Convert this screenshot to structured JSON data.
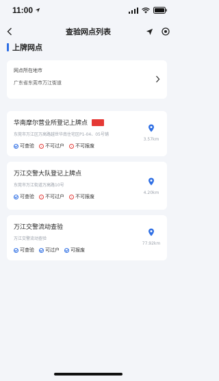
{
  "status_bar": {
    "time": "11:00"
  },
  "nav": {
    "title": "查验网点列表"
  },
  "section": {
    "title": "上牌网点"
  },
  "city": {
    "label": "网点所在地市",
    "value": "广东省东莞市万江街道"
  },
  "sites": [
    {
      "name": "华南摩尔营业所登记上牌点",
      "address": "东莞市万江区万高路越世华南住宅区P1-04、05号铺",
      "distance": "3.57km",
      "tags": [
        {
          "label": "可查验",
          "status": "ok"
        },
        {
          "label": "不可过户",
          "status": "no"
        },
        {
          "label": "不可报废",
          "status": "no"
        }
      ]
    },
    {
      "name": "万江交警大队登记上牌点",
      "address": "东莞市万江街道万高路10号",
      "distance": "4.20km",
      "tags": [
        {
          "label": "可查验",
          "status": "ok"
        },
        {
          "label": "不可过户",
          "status": "no"
        },
        {
          "label": "不可报废",
          "status": "no"
        }
      ]
    },
    {
      "name": "万江交警流动查验",
      "address": "万江交警流动查验",
      "distance": "77.92km",
      "tags": [
        {
          "label": "可查验",
          "status": "ok"
        },
        {
          "label": "可过户",
          "status": "ok"
        },
        {
          "label": "可报废",
          "status": "ok"
        }
      ]
    }
  ],
  "colors": {
    "accent": "#2f6fe4",
    "danger": "#e53935",
    "background": "#f3f5f9"
  }
}
